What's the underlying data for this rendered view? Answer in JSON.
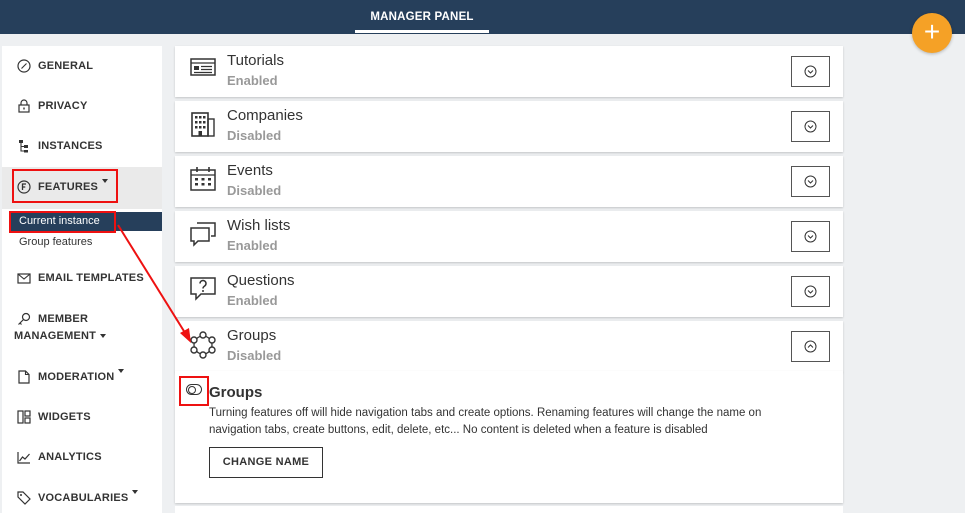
{
  "header": {
    "title": "MANAGER PANEL"
  },
  "fab": {
    "icon": "plus-icon",
    "color": "#f5a126"
  },
  "sidebar": {
    "items": [
      {
        "label": "GENERAL",
        "icon": "compass-icon"
      },
      {
        "label": "PRIVACY",
        "icon": "lock-icon"
      },
      {
        "label": "INSTANCES",
        "icon": "hierarchy-icon"
      },
      {
        "label": "FEATURES",
        "icon": "f-circle-icon"
      },
      {
        "label": "EMAIL TEMPLATES",
        "icon": "envelope-icon"
      },
      {
        "label": "MEMBER",
        "label2": "MANAGEMENT",
        "icon": "key-icon"
      },
      {
        "label": "MODERATION",
        "icon": "document-icon"
      },
      {
        "label": "WIDGETS",
        "icon": "widgets-icon"
      },
      {
        "label": "ANALYTICS",
        "icon": "chart-icon"
      },
      {
        "label": "VOCABULARIES",
        "icon": "tag-icon"
      }
    ],
    "features_sub": {
      "current": "Current instance",
      "group": "Group features"
    }
  },
  "features": [
    {
      "name": "Tutorials",
      "status": "Enabled",
      "icon": "tutorial-icon"
    },
    {
      "name": "Companies",
      "status": "Disabled",
      "icon": "building-icon"
    },
    {
      "name": "Events",
      "status": "Disabled",
      "icon": "calendar-icon"
    },
    {
      "name": "Wish lists",
      "status": "Enabled",
      "icon": "chat-bubbles-icon"
    },
    {
      "name": "Questions",
      "status": "Enabled",
      "icon": "question-icon"
    },
    {
      "name": "Groups",
      "status": "Disabled",
      "icon": "groups-icon"
    }
  ],
  "detail": {
    "title": "Groups",
    "description": "Turning features off will hide navigation tabs and create options. Renaming features will change the name on navigation tabs, create buttons, edit, delete, etc... No content is deleted when a feature is disabled",
    "button": "CHANGE NAME"
  },
  "colors": {
    "header": "#263f5b",
    "annotation": "#ee1111",
    "accent": "#f5a126"
  }
}
